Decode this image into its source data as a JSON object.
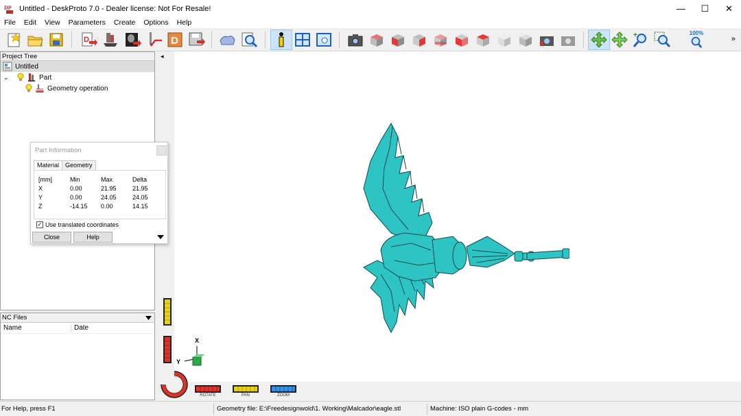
{
  "window": {
    "title": "Untitled - DeskProto 7.0 - Dealer license: Not For Resale!",
    "minimize": "—",
    "maximize": "☐",
    "close": "✕"
  },
  "menu": [
    "File",
    "Edit",
    "View",
    "Parameters",
    "Create",
    "Options",
    "Help"
  ],
  "toolbar": {
    "zoom_label": "100%",
    "more": "»"
  },
  "project_tree": {
    "header": "Project Tree",
    "root": "Untitled",
    "part": "Part",
    "operation": "Geometry operation",
    "expander": "⌄"
  },
  "nc_files": {
    "header": "NC Files",
    "col_name": "Name",
    "col_date": "Date"
  },
  "part_info": {
    "title": "Part Information",
    "tabs": [
      "Material",
      "Geometry"
    ],
    "headers": [
      "[mm]",
      "Min",
      "Max",
      "Delta"
    ],
    "rows": [
      [
        "X",
        "0.00",
        "21.95",
        "21.95"
      ],
      [
        "Y",
        "0.00",
        "24.05",
        "24.05"
      ],
      [
        "Z",
        "-14.15",
        "0.00",
        "14.15"
      ]
    ],
    "checkbox_label": "Use translated coordinates",
    "checkbox_checked": true,
    "check_mark": "✓",
    "close_button": "Close",
    "help_button": "Help"
  },
  "viewport": {
    "axis_x": "X",
    "axis_y": "Y",
    "collapse_arrow": "◂",
    "modes": [
      "ROTATE",
      "PAN",
      "ZOOM"
    ],
    "colors": {
      "rotate": "#e03a2a",
      "pan": "#e7d21a",
      "zoom": "#3a8de0",
      "model": "#2ec4c4"
    }
  },
  "status": {
    "help": "For Help, press F1",
    "geometry_file": "Geometry file: E:\\Freedesignwold\\1. Working\\Malcador\\eagle.stl",
    "machine": "Machine: ISO plain G-codes - mm"
  }
}
